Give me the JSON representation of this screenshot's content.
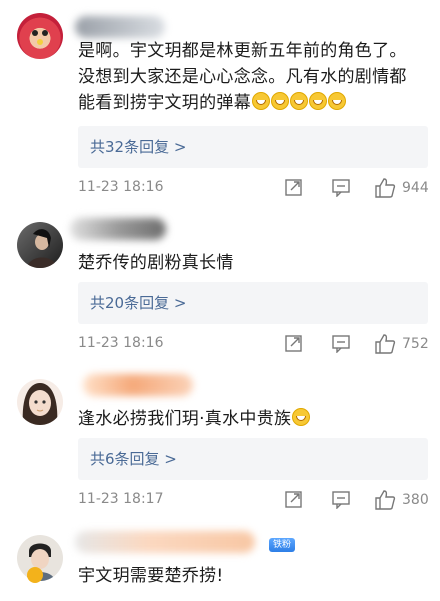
{
  "comments": [
    {
      "text_lines": [
        "是啊。宇文玥都是林更新五年前的角色了。",
        "没想到大家还是心心念念。凡有水的剧情都",
        "能看到捞宇文玥的弹幕"
      ],
      "replies": "共32条回复 >",
      "time": "11-23 18:16",
      "likes": "944"
    },
    {
      "text_lines": [
        "楚乔传的剧粉真长情"
      ],
      "replies": "共20条回复 >",
      "time": "11-23 18:16",
      "likes": "752"
    },
    {
      "text_lines": [
        "逢水必捞我们玥·真水中贵族"
      ],
      "replies": "共6条回复 >",
      "time": "11-23 18:17",
      "likes": "380"
    },
    {
      "text_lines": [
        "宇文玥需要楚乔捞!"
      ]
    }
  ],
  "badge": "铁粉",
  "icons": [
    "share-icon",
    "comment-icon",
    "like-icon",
    "smile-emoji-icon"
  ],
  "colors": {
    "reply_link": "#4a6a96",
    "reply_bg": "#f4f5f7",
    "meta": "#8a8a8a"
  }
}
